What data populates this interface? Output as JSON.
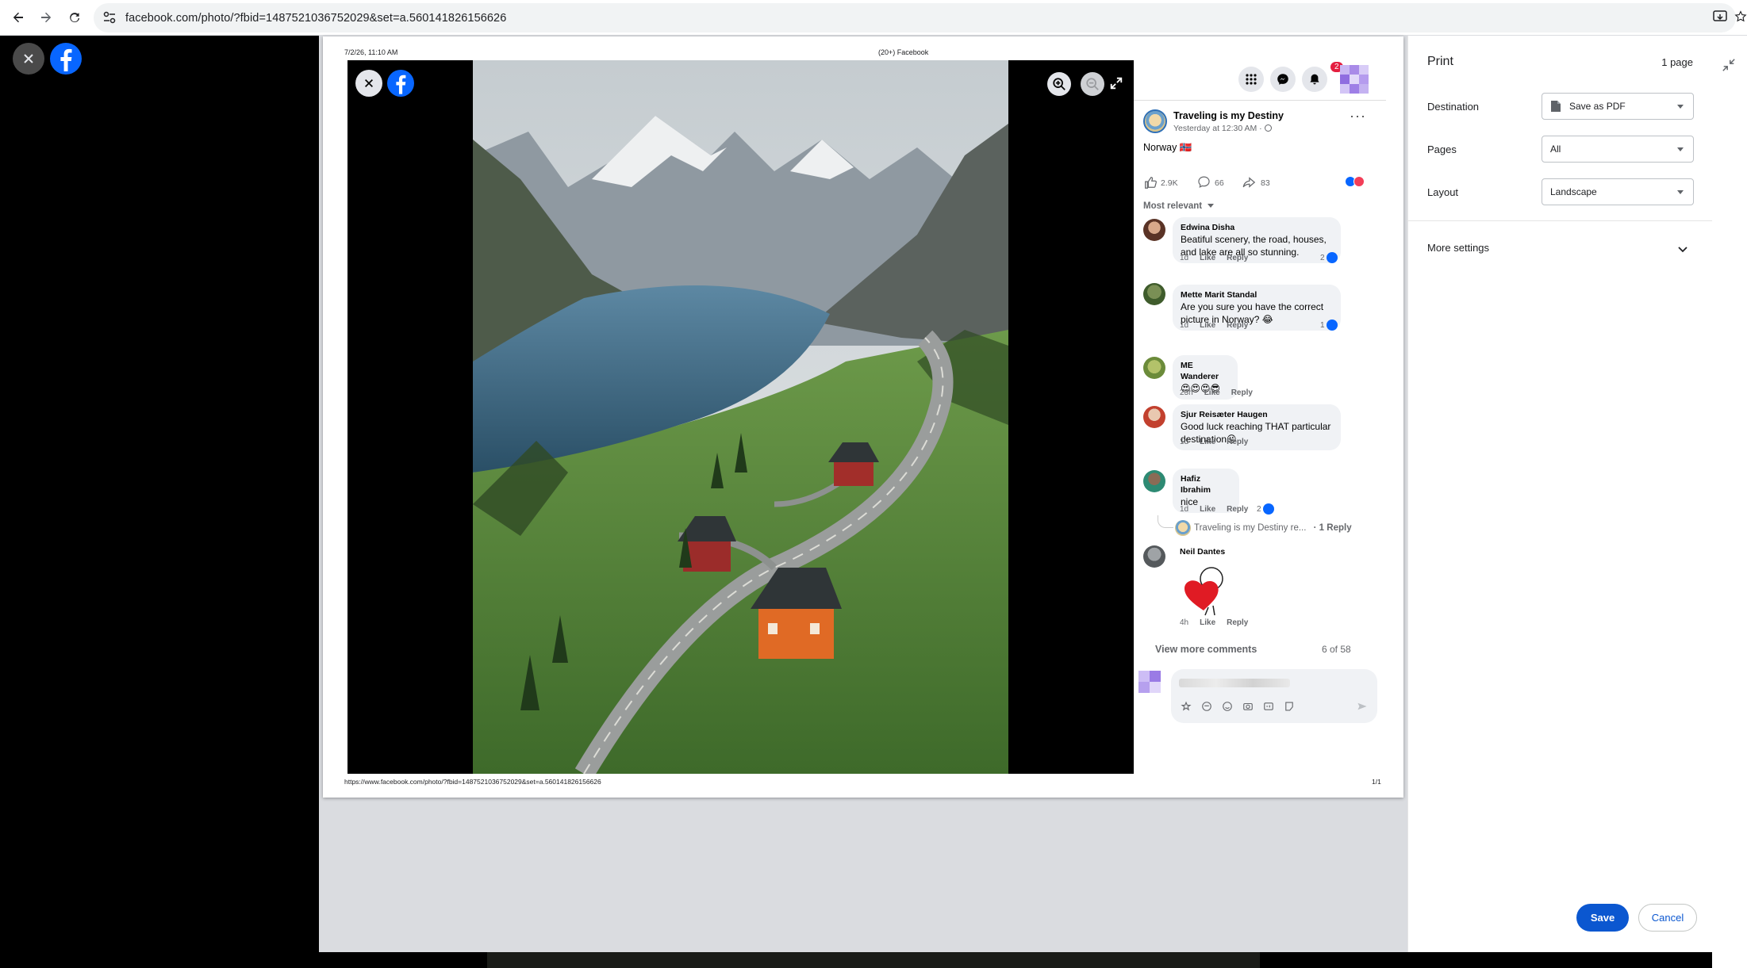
{
  "browser": {
    "url": "facebook.com/photo/?fbid=1487521036752029&set=a.560141826156626"
  },
  "print_page": {
    "header_left": "7/2/26, 11:10 AM",
    "header_center": "(20+) Facebook",
    "footer_url": "https://www.facebook.com/photo/?fbid=1487521036752029&set=a.560141826156626",
    "footer_page": "1/1"
  },
  "post": {
    "author": "Traveling is my Destiny",
    "time": "Yesterday at 12:30 AM · ",
    "caption": "Norway 🇳🇴",
    "notifications_badge": "2",
    "likes": "2.9K",
    "comments": "66",
    "shares": "83",
    "sort_label": "Most relevant",
    "view_more": "View more comments",
    "count": "6 of 58"
  },
  "comments": [
    {
      "name": "Edwina Disha",
      "line1": "Beatiful scenery, the road, houses,",
      "line2": "and lake are all so stunning.",
      "age": "1d",
      "like": "Like",
      "reply": "Reply",
      "reactions": "2"
    },
    {
      "name": "Mette Marit Standal",
      "line1": "Are you sure you have the correct",
      "line2": "picture in Norway? 😂",
      "age": "1d",
      "like": "Like",
      "reply": "Reply",
      "reactions": "1"
    },
    {
      "name": "ME Wanderer",
      "line1": "😍😍😍😎",
      "age": "23h",
      "like": "Like",
      "reply": "Reply"
    },
    {
      "name": "Sjur Reisæter Haugen",
      "line1": "Good luck reaching THAT particular",
      "line2": "destination😜",
      "age": "1d",
      "like": "Like",
      "reply": "Reply"
    },
    {
      "name": "Hafiz Ibrahim",
      "line1": "nice",
      "age": "1d",
      "like": "Like",
      "reply": "Reply",
      "reactions": "2",
      "reply_preview": "Traveling is my Destiny re...",
      "reply_count": "· 1 Reply"
    },
    {
      "name": "Neil Dantes",
      "age": "4h",
      "like": "Like",
      "reply": "Reply"
    }
  ],
  "print_settings": {
    "title": "Print",
    "pages_count": "1 page",
    "destination_label": "Destination",
    "destination_value": "Save as PDF",
    "pages_label": "Pages",
    "pages_value": "All",
    "layout_label": "Layout",
    "layout_value": "Landscape",
    "more_settings": "More settings",
    "save": "Save",
    "cancel": "Cancel"
  },
  "colors": {
    "fb_blue": "#0866ff",
    "chrome_blue": "#0b57d0",
    "badge_red": "#e41e3f"
  }
}
